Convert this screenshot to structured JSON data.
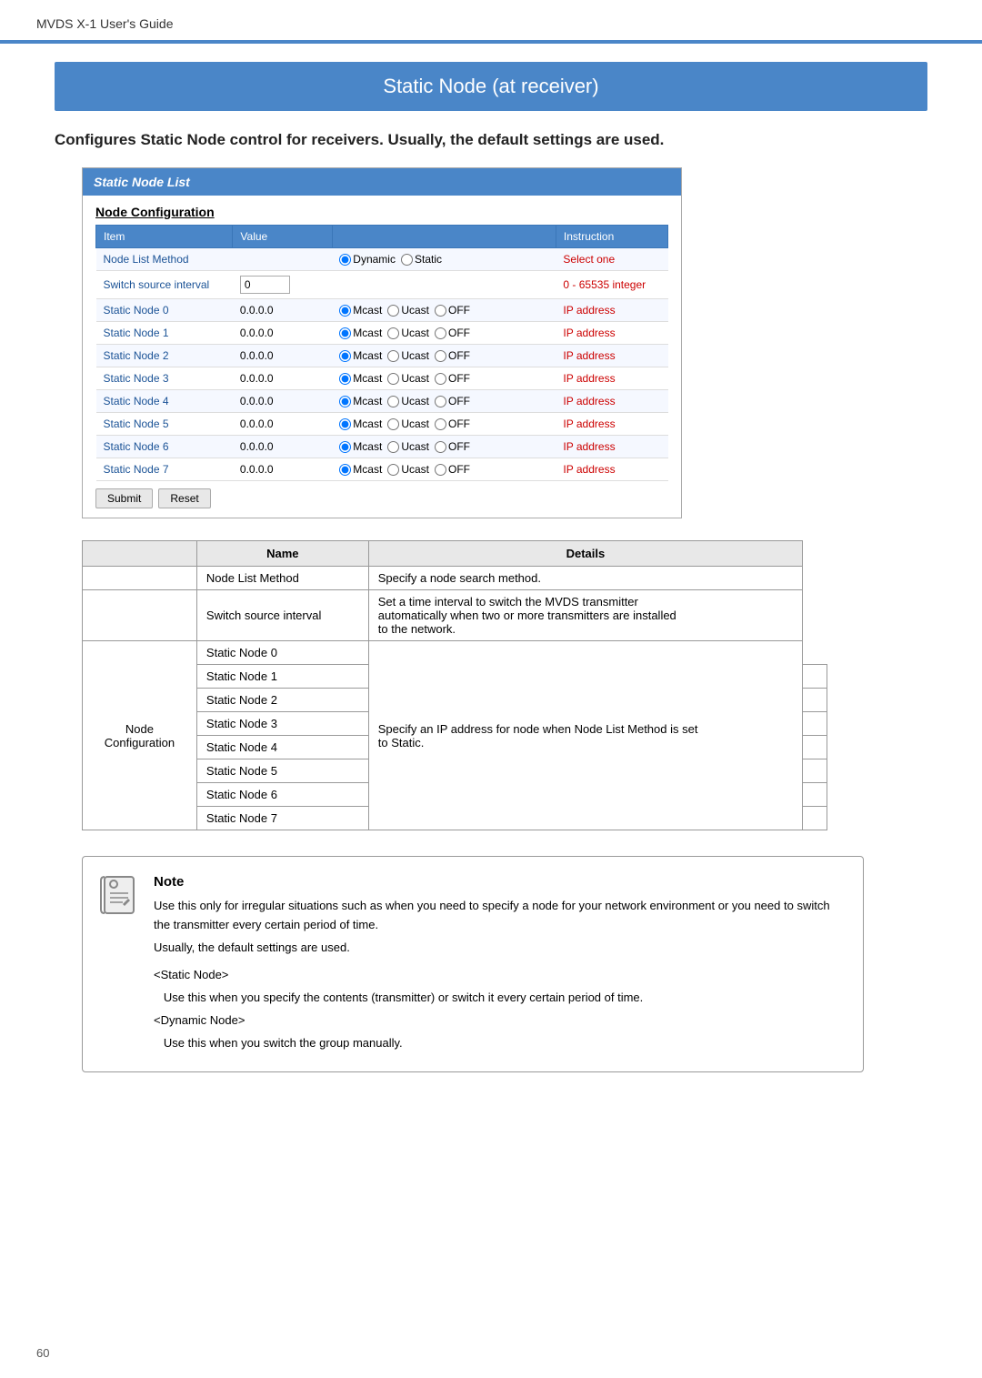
{
  "header": {
    "title": "MVDS X-1 User's Guide"
  },
  "section": {
    "title": "Static Node (at receiver)",
    "subtitle": "Configures Static Node control for receivers. Usually, the default settings are used."
  },
  "panel": {
    "title": "Static Node List",
    "node_config_heading": "Node Configuration"
  },
  "table": {
    "columns": [
      "Item",
      "Value",
      "",
      "Instruction"
    ],
    "rows": [
      {
        "item": "Node List Method",
        "value_type": "radio_dynamic_static",
        "instruction": "Select one"
      },
      {
        "item": "Switch source interval",
        "value_type": "text",
        "value": "0",
        "instruction": "0 - 65535 integer"
      },
      {
        "item": "Static Node 0",
        "value_type": "ip_radio",
        "value": "0.0.0.0",
        "instruction": "IP address"
      },
      {
        "item": "Static Node 1",
        "value_type": "ip_radio",
        "value": "0.0.0.0",
        "instruction": "IP address"
      },
      {
        "item": "Static Node 2",
        "value_type": "ip_radio",
        "value": "0.0.0.0",
        "instruction": "IP address"
      },
      {
        "item": "Static Node 3",
        "value_type": "ip_radio",
        "value": "0.0.0.0",
        "instruction": "IP address"
      },
      {
        "item": "Static Node 4",
        "value_type": "ip_radio",
        "value": "0.0.0.0",
        "instruction": "IP address"
      },
      {
        "item": "Static Node 5",
        "value_type": "ip_radio",
        "value": "0.0.0.0",
        "instruction": "IP address"
      },
      {
        "item": "Static Node 6",
        "value_type": "ip_radio",
        "value": "0.0.0.0",
        "instruction": "IP address"
      },
      {
        "item": "Static Node 7",
        "value_type": "ip_radio",
        "value": "0.0.0.0",
        "instruction": "IP address"
      }
    ],
    "submit_label": "Submit",
    "reset_label": "Reset"
  },
  "details_table": {
    "col_name": "Name",
    "col_details": "Details",
    "rows": [
      {
        "name": "Node List Method",
        "details": "Specify a node search method.",
        "rowspan": 1,
        "label": ""
      },
      {
        "name": "Switch source interval",
        "details": "Set a time interval to switch the MVDS transmitter automatically when two or more transmitters are installed to the network.",
        "rowspan": 1,
        "label": ""
      },
      {
        "name": "Static Node 0",
        "details": "Specify an IP address for node when Node List Method is set to Static.",
        "rowspan": 8,
        "label": "Node\nConfiguration"
      },
      {
        "name": "Static Node 1",
        "details": "",
        "rowspan": 0
      },
      {
        "name": "Static Node 2",
        "details": "",
        "rowspan": 0
      },
      {
        "name": "Static Node 3",
        "details": "",
        "rowspan": 0
      },
      {
        "name": "Static Node 4",
        "details": "",
        "rowspan": 0
      },
      {
        "name": "Static Node 5",
        "details": "",
        "rowspan": 0
      },
      {
        "name": "Static Node 6",
        "details": "",
        "rowspan": 0
      },
      {
        "name": "Static Node 7",
        "details": "",
        "rowspan": 0
      }
    ]
  },
  "note": {
    "icon": "📝",
    "bold_label": "Note",
    "lines": [
      "Use this only for irregular situations such as when you need to specify a node for your network environment or you need to switch the transmitter every certain period of time.",
      "Usually, the default settings are used."
    ],
    "static_node_tag": "<Static Node>",
    "static_node_desc": "Use this when you specify the contents (transmitter) or switch it every certain period of time.",
    "dynamic_node_tag": "<Dynamic Node>",
    "dynamic_node_desc": "Use this when you switch the group manually."
  },
  "footer": {
    "page_number": "60"
  }
}
